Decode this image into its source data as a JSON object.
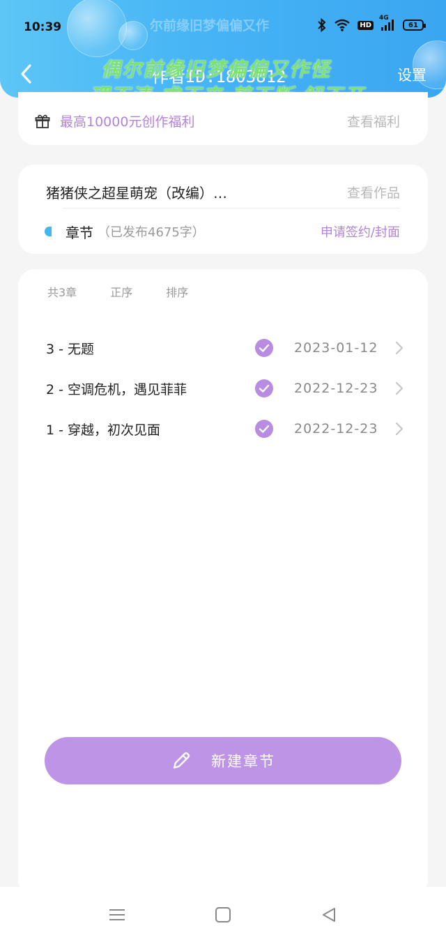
{
  "status_bar": {
    "time": "10:39",
    "network": "4G",
    "hd_label": "HD",
    "battery": "61"
  },
  "header": {
    "faint_title": "尔前缘旧梦偏偏又作",
    "author_id": "作者ID:1803812",
    "settings_label": "设置",
    "watermark_line1": "偶尔前缘旧梦偏偏又作怪",
    "watermark_line2": "理不清 求不来 剪不断 解不开"
  },
  "benefit": {
    "text": "最高10000元创作福利",
    "link": "查看福利"
  },
  "work": {
    "title": "猪猪侠之超星萌宠（改编）…",
    "view_link": "查看作品",
    "chapter_label": "章节",
    "chapter_count": "（已发布4675字）",
    "sign_link": "申请签约/封面"
  },
  "chapter_list": {
    "total": "共3章",
    "order": "正序",
    "sort": "排序",
    "items": [
      {
        "name": "3 - 无题",
        "date": "2023-01-12"
      },
      {
        "name": "2 - 空调危机，遇见菲菲",
        "date": "2022-12-23"
      },
      {
        "name": "1 - 穿越，初次见面",
        "date": "2022-12-23"
      }
    ]
  },
  "new_chapter_label": "新建章节",
  "colors": {
    "header_blue": "#46b4f5",
    "accent_purple": "#be94e6",
    "check_purple": "#b88ce0",
    "link_purple": "#b382d9",
    "watermark_green": "#7ee26f"
  },
  "icons": {
    "back": "chevron-left-icon",
    "gift": "gift-icon",
    "check": "check-circle-icon",
    "arrow": "chevron-right-icon",
    "pencil": "pencil-icon",
    "nav_menu": "menu-icon",
    "nav_home": "square-icon",
    "nav_back": "triangle-back-icon"
  }
}
